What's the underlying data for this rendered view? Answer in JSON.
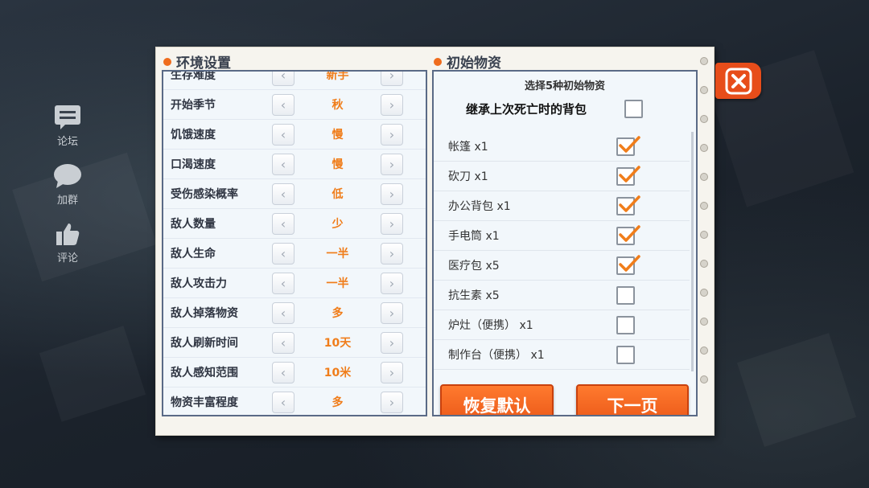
{
  "sidebar": {
    "forum_label": "论坛",
    "group_label": "加群",
    "review_label": "评论"
  },
  "env": {
    "title": "环境设置",
    "rows": [
      {
        "label": "生存难度",
        "value": "新手"
      },
      {
        "label": "开始季节",
        "value": "秋"
      },
      {
        "label": "饥饿速度",
        "value": "慢"
      },
      {
        "label": "口渴速度",
        "value": "慢"
      },
      {
        "label": "受伤感染概率",
        "value": "低"
      },
      {
        "label": "敌人数量",
        "value": "少"
      },
      {
        "label": "敌人生命",
        "value": "一半"
      },
      {
        "label": "敌人攻击力",
        "value": "一半"
      },
      {
        "label": "敌人掉落物资",
        "value": "多"
      },
      {
        "label": "敌人刷新时间",
        "value": "10天"
      },
      {
        "label": "敌人感知范围",
        "value": "10米"
      },
      {
        "label": "物资丰富程度",
        "value": "多"
      }
    ],
    "prev_glyph": "‹",
    "next_glyph": "›"
  },
  "items": {
    "title": "初始物资",
    "subtitle": "选择5种初始物资",
    "inherit_label": "继承上次死亡时的背包",
    "inherit_checked": false,
    "list": [
      {
        "name": "帐篷 x1",
        "checked": true
      },
      {
        "name": "砍刀 x1",
        "checked": true
      },
      {
        "name": "办公背包 x1",
        "checked": true
      },
      {
        "name": "手电筒 x1",
        "checked": true
      },
      {
        "name": "医疗包 x5",
        "checked": true
      },
      {
        "name": "抗生素 x5",
        "checked": false
      },
      {
        "name": "炉灶（便携） x1",
        "checked": false
      },
      {
        "name": "制作台（便携） x1",
        "checked": false
      }
    ],
    "reset_label": "恢复默认",
    "next_label": "下一页"
  },
  "colors": {
    "accent_orange": "#ef6c1d",
    "value_orange": "#f07d1a",
    "panel_border": "#5a6a86",
    "close_red": "#e74d1a"
  },
  "icons": {
    "close": "close-icon",
    "forum": "forum-icon",
    "group": "chat-bubble-icon",
    "review": "thumbs-up-icon",
    "check": "checkmark-icon"
  }
}
